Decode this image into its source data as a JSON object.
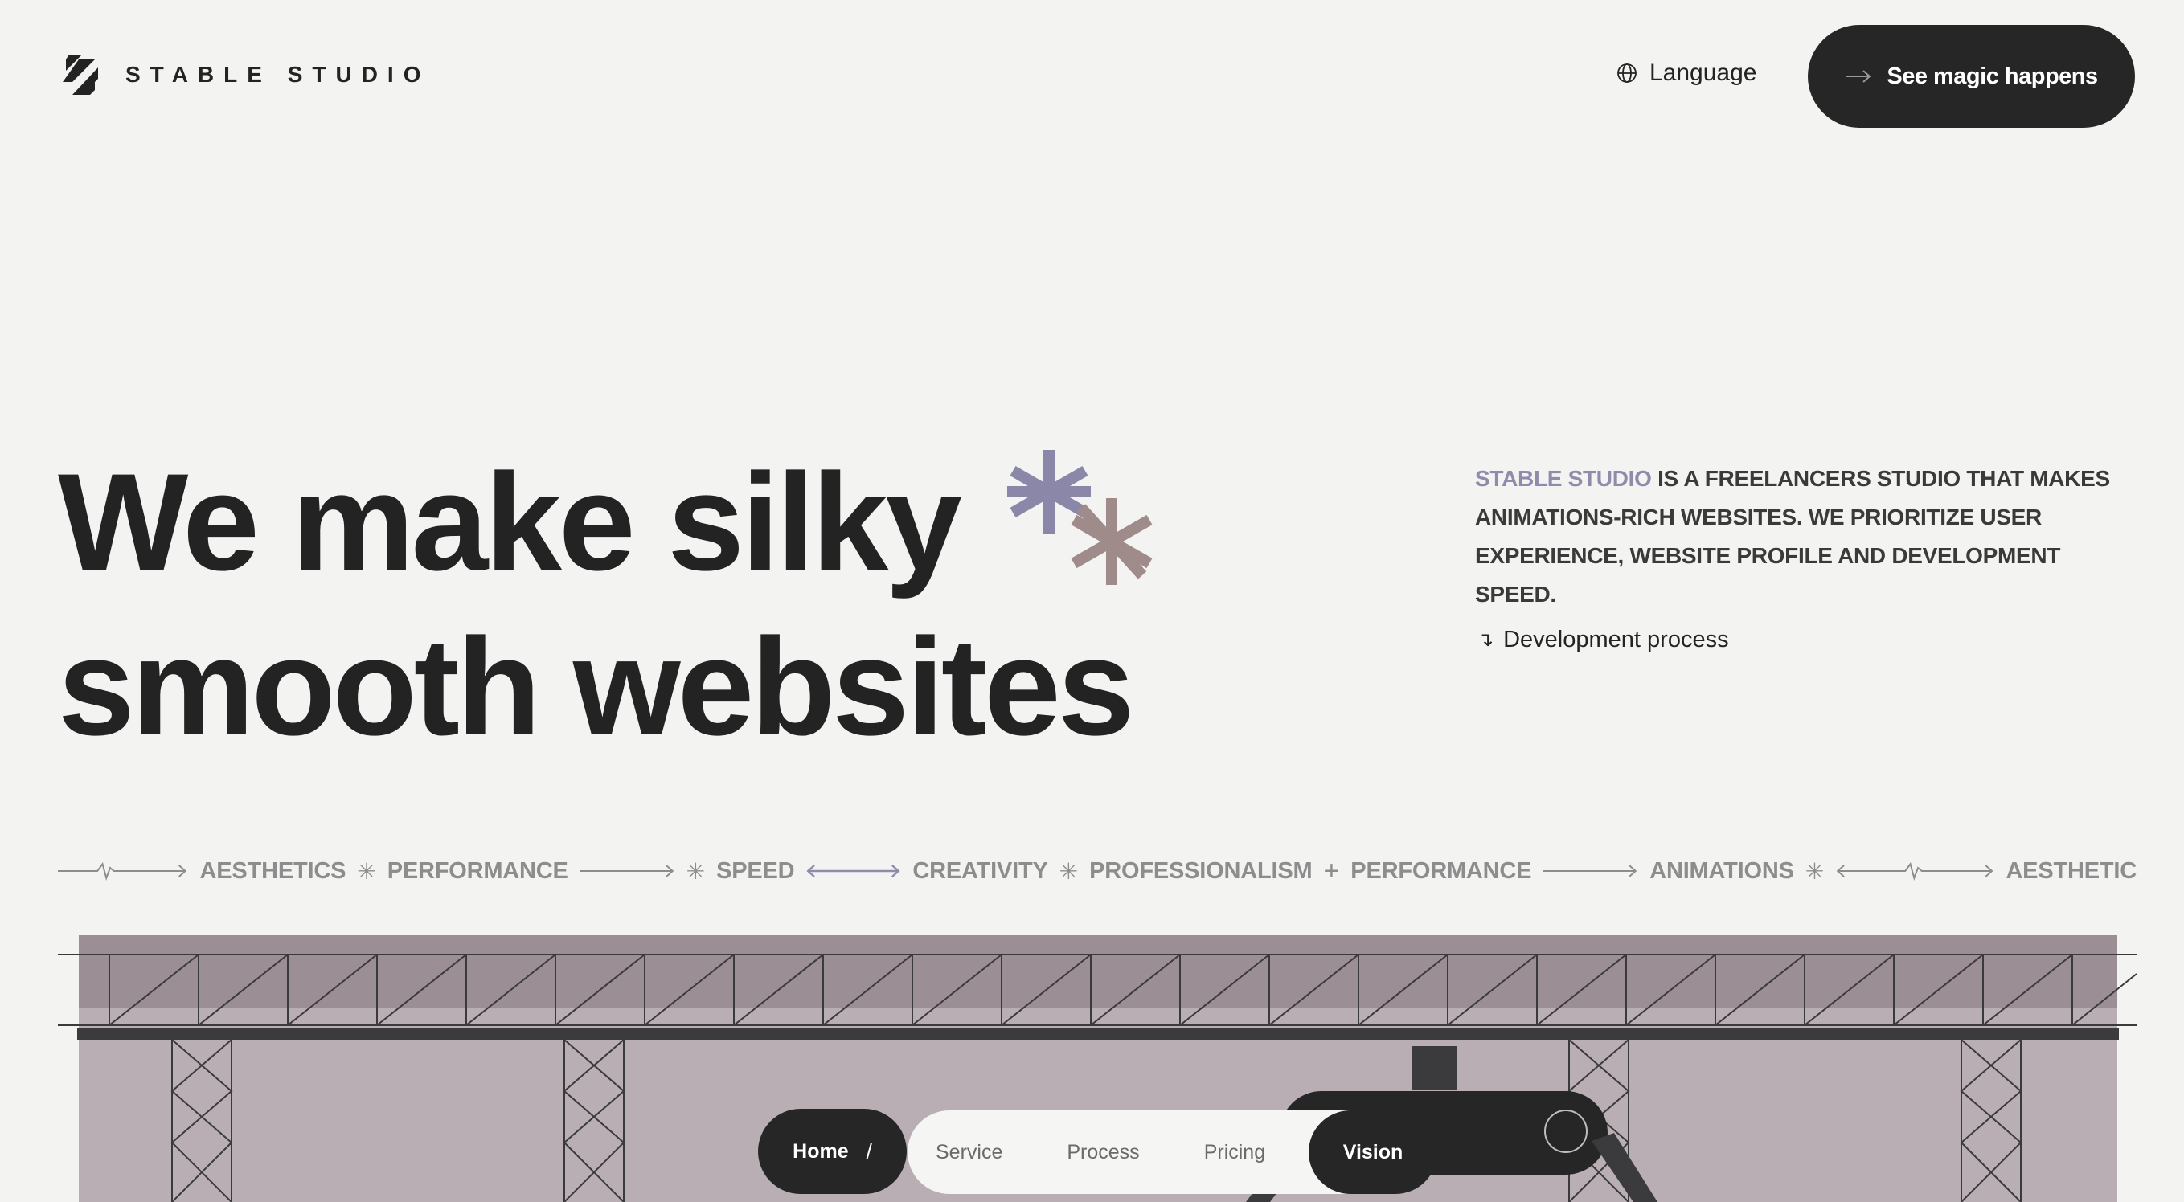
{
  "header": {
    "brand": "STABLE STUDIO",
    "language_label": "Language",
    "cta_label": "See magic happens"
  },
  "hero": {
    "title_line1": "We make silky",
    "title_line2": "smooth websites",
    "description_brand": "STABLE STUDIO",
    "description_rest": " IS A FREELANCERS STUDIO THAT MAKES ANIMATIONS-RICH WEBSITES. WE PRIORITIZE USER EXPERIENCE, WEBSITE PROFILE AND DEVELOPMENT SPEED.",
    "dev_link": "Development process"
  },
  "marquee": {
    "words": [
      "AESTHETICS",
      "PERFORMANCE",
      "SPEED",
      "CREATIVITY",
      "PROFESSIONALISM",
      "PERFORMANCE",
      "ANIMATIONS",
      "AESTHETIC"
    ]
  },
  "bottom_nav": {
    "home": "Home",
    "slash": "/",
    "items": [
      "Service",
      "Process",
      "Pricing"
    ],
    "active": "Vision"
  },
  "colors": {
    "background": "#f3f3f1",
    "dark": "#262626",
    "brand_lavender": "#8f8bab",
    "asterisk_purple": "#8a87a8",
    "asterisk_mauve": "#a08b8b",
    "illustration_top": "#9b8e95",
    "illustration_bottom": "#b8aeb3"
  }
}
